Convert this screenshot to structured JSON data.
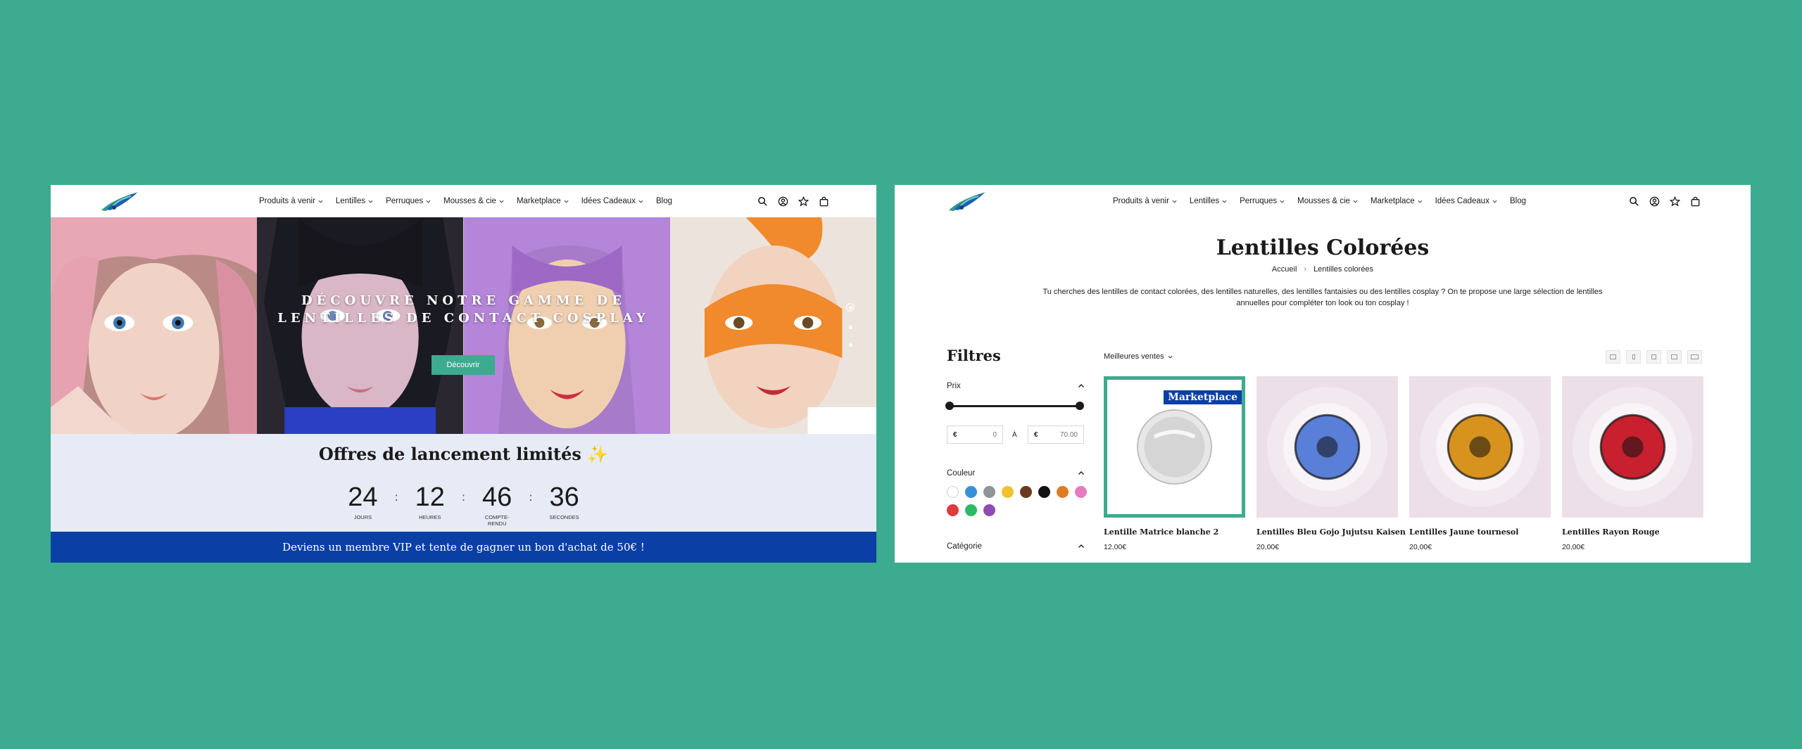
{
  "nav": {
    "items": [
      {
        "label": "Produits à venir"
      },
      {
        "label": "Lentilles"
      },
      {
        "label": "Perruques"
      },
      {
        "label": "Mousses & cie"
      },
      {
        "label": "Marketplace"
      },
      {
        "label": "Idées Cadeaux"
      },
      {
        "label": "Blog"
      }
    ],
    "icons": [
      "search-icon",
      "account-icon",
      "wishlist-star-icon",
      "shopping-bag-icon"
    ]
  },
  "hero": {
    "title_line1": "DÉCOUVRE NOTRE GAMME DE",
    "title_line2": "LENTILLES DE CONTACT COSPLAY",
    "button": "Découvrir",
    "slides": 3,
    "active_slide": 1
  },
  "countdown": {
    "title": "Offres de lancement limités ✨",
    "units": [
      {
        "value": "24",
        "label": "JOURS"
      },
      {
        "value": "12",
        "label": "HEURES"
      },
      {
        "value": "46",
        "label": "COMPTE-RENDU"
      },
      {
        "value": "36",
        "label": "SECONDES"
      }
    ]
  },
  "vip_banner": "Deviens un membre VIP et tente de gagner un bon d'achat de 50€ !",
  "collection": {
    "title": "Lentilles Colorées",
    "breadcrumb": {
      "home": "Accueil",
      "current": "Lentilles colorées"
    },
    "intro": "Tu cherches des lentilles de contact colorées, des lentilles naturelles, des lentilles fantaisies ou des lentilles cosplay ? On te propose une large sélection de lentilles annuelles pour compléter ton look ou ton cosplay !"
  },
  "filters": {
    "title": "Filtres",
    "price_label": "Prix",
    "price_min": "0",
    "price_max": "70.00",
    "currency": "€",
    "to_label": "À",
    "color_label": "Couleur",
    "colors": [
      "#ffffff",
      "#3a8fd9",
      "#8f9498",
      "#f2c12e",
      "#6b3a1c",
      "#111111",
      "#e07b25",
      "#e87bc0",
      "#e03b3b",
      "#2fb866",
      "#8e4bb3"
    ],
    "category_label": "Catégorie"
  },
  "sort": {
    "label": "Meilleures ventes"
  },
  "products": [
    {
      "name": "Lentille Matrice blanche 2",
      "price": "12,00€",
      "badge": "Marketplace",
      "lens_color": "#c9c9c9",
      "featured": true
    },
    {
      "name": "Lentilles Bleu Gojo Jujutsu Kaisen",
      "price": "20,00€",
      "badge": "",
      "lens_color": "#5a7fd8",
      "featured": false
    },
    {
      "name": "Lentilles Jaune tournesol",
      "price": "20,00€",
      "badge": "",
      "lens_color": "#d8931e",
      "featured": false
    },
    {
      "name": "Lentilles Rayon Rouge",
      "price": "20,00€",
      "badge": "",
      "lens_color": "#c8202f",
      "featured": false
    }
  ]
}
